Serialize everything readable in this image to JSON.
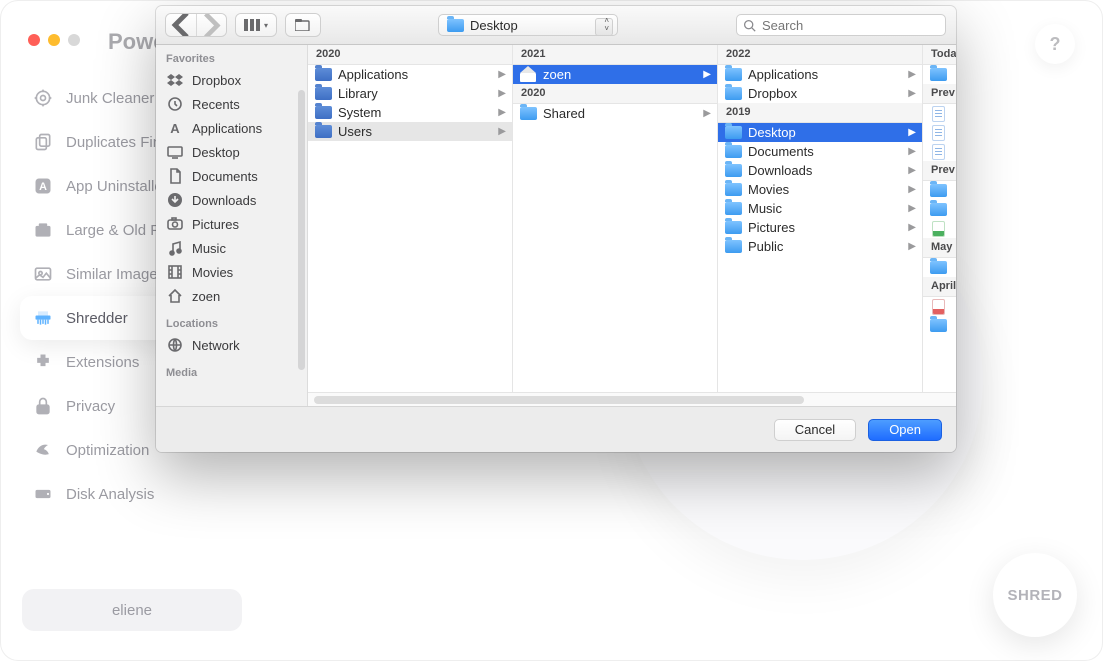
{
  "app": {
    "title": "Powe",
    "user": "eliene",
    "shred_label": "SHRED",
    "help": "?"
  },
  "sidebar": {
    "items": [
      {
        "id": "junk",
        "label": "Junk Cleaner"
      },
      {
        "id": "dups",
        "label": "Duplicates Finder"
      },
      {
        "id": "uninstall",
        "label": "App Uninstaller"
      },
      {
        "id": "large",
        "label": "Large & Old Files"
      },
      {
        "id": "similar",
        "label": "Similar Image Finder"
      },
      {
        "id": "shredder",
        "label": "Shredder",
        "selected": true
      },
      {
        "id": "ext",
        "label": "Extensions"
      },
      {
        "id": "privacy",
        "label": "Privacy"
      },
      {
        "id": "opt",
        "label": "Optimization"
      },
      {
        "id": "disk",
        "label": "Disk Analysis"
      }
    ]
  },
  "dialog": {
    "location": "Desktop",
    "search_placeholder": "Search",
    "cancel": "Cancel",
    "open": "Open",
    "favorites_label": "Favorites",
    "locations_label": "Locations",
    "media_label": "Media",
    "favorites": [
      {
        "label": "Dropbox",
        "icon": "dropbox"
      },
      {
        "label": "Recents",
        "icon": "clock"
      },
      {
        "label": "Applications",
        "icon": "apps"
      },
      {
        "label": "Desktop",
        "icon": "desktop"
      },
      {
        "label": "Documents",
        "icon": "doc"
      },
      {
        "label": "Downloads",
        "icon": "download"
      },
      {
        "label": "Pictures",
        "icon": "camera"
      },
      {
        "label": "Music",
        "icon": "music"
      },
      {
        "label": "Movies",
        "icon": "film"
      },
      {
        "label": "zoen",
        "icon": "home"
      }
    ],
    "locations": [
      {
        "label": "Network",
        "icon": "globe"
      }
    ],
    "columns": [
      {
        "header": "2020",
        "items": [
          {
            "label": "Applications",
            "icon": "folder-dark",
            "arrow": true
          },
          {
            "label": "Library",
            "icon": "folder-dark",
            "arrow": true
          },
          {
            "label": "System",
            "icon": "folder-dark",
            "arrow": true
          },
          {
            "label": "Users",
            "icon": "folder-dark",
            "arrow": true,
            "state": "lit"
          }
        ]
      },
      {
        "header": "2021",
        "items": [
          {
            "label": "zoen",
            "icon": "home",
            "arrow": true,
            "state": "sel"
          },
          {
            "label": "2020",
            "header_like": true
          },
          {
            "label": "Shared",
            "icon": "folder-blue",
            "arrow": true
          }
        ]
      },
      {
        "header": "2022",
        "items": [
          {
            "label": "Applications",
            "icon": "folder-blue",
            "arrow": true
          },
          {
            "label": "Dropbox",
            "icon": "folder-blue",
            "arrow": true
          },
          {
            "label": "2019",
            "header_like": true
          },
          {
            "label": "Desktop",
            "icon": "folder-blue",
            "arrow": true,
            "state": "sel"
          },
          {
            "label": "Documents",
            "icon": "folder-blue",
            "arrow": true
          },
          {
            "label": "Downloads",
            "icon": "folder-blue",
            "arrow": true
          },
          {
            "label": "Movies",
            "icon": "folder-blue",
            "arrow": true
          },
          {
            "label": "Music",
            "icon": "folder-blue",
            "arrow": true
          },
          {
            "label": "Pictures",
            "icon": "folder-blue",
            "arrow": true
          },
          {
            "label": "Public",
            "icon": "folder-blue",
            "arrow": true
          }
        ]
      },
      {
        "header": "Today",
        "items": [
          {
            "label": "",
            "icon": "folder-blue"
          },
          {
            "label": "Prev",
            "header_like": true
          },
          {
            "label": "",
            "icon": "doc-blue"
          },
          {
            "label": "",
            "icon": "doc-blue"
          },
          {
            "label": "",
            "icon": "doc-blue"
          },
          {
            "label": "Prev",
            "header_like": true
          },
          {
            "label": "",
            "icon": "folder-blue"
          },
          {
            "label": "",
            "icon": "folder-blue"
          },
          {
            "label": "",
            "icon": "doc-grn"
          },
          {
            "label": "May",
            "header_like": true
          },
          {
            "label": "",
            "icon": "folder-blue"
          },
          {
            "label": "April",
            "header_like": true
          },
          {
            "label": "",
            "icon": "doc-red"
          },
          {
            "label": "",
            "icon": "folder-blue"
          }
        ]
      }
    ]
  }
}
